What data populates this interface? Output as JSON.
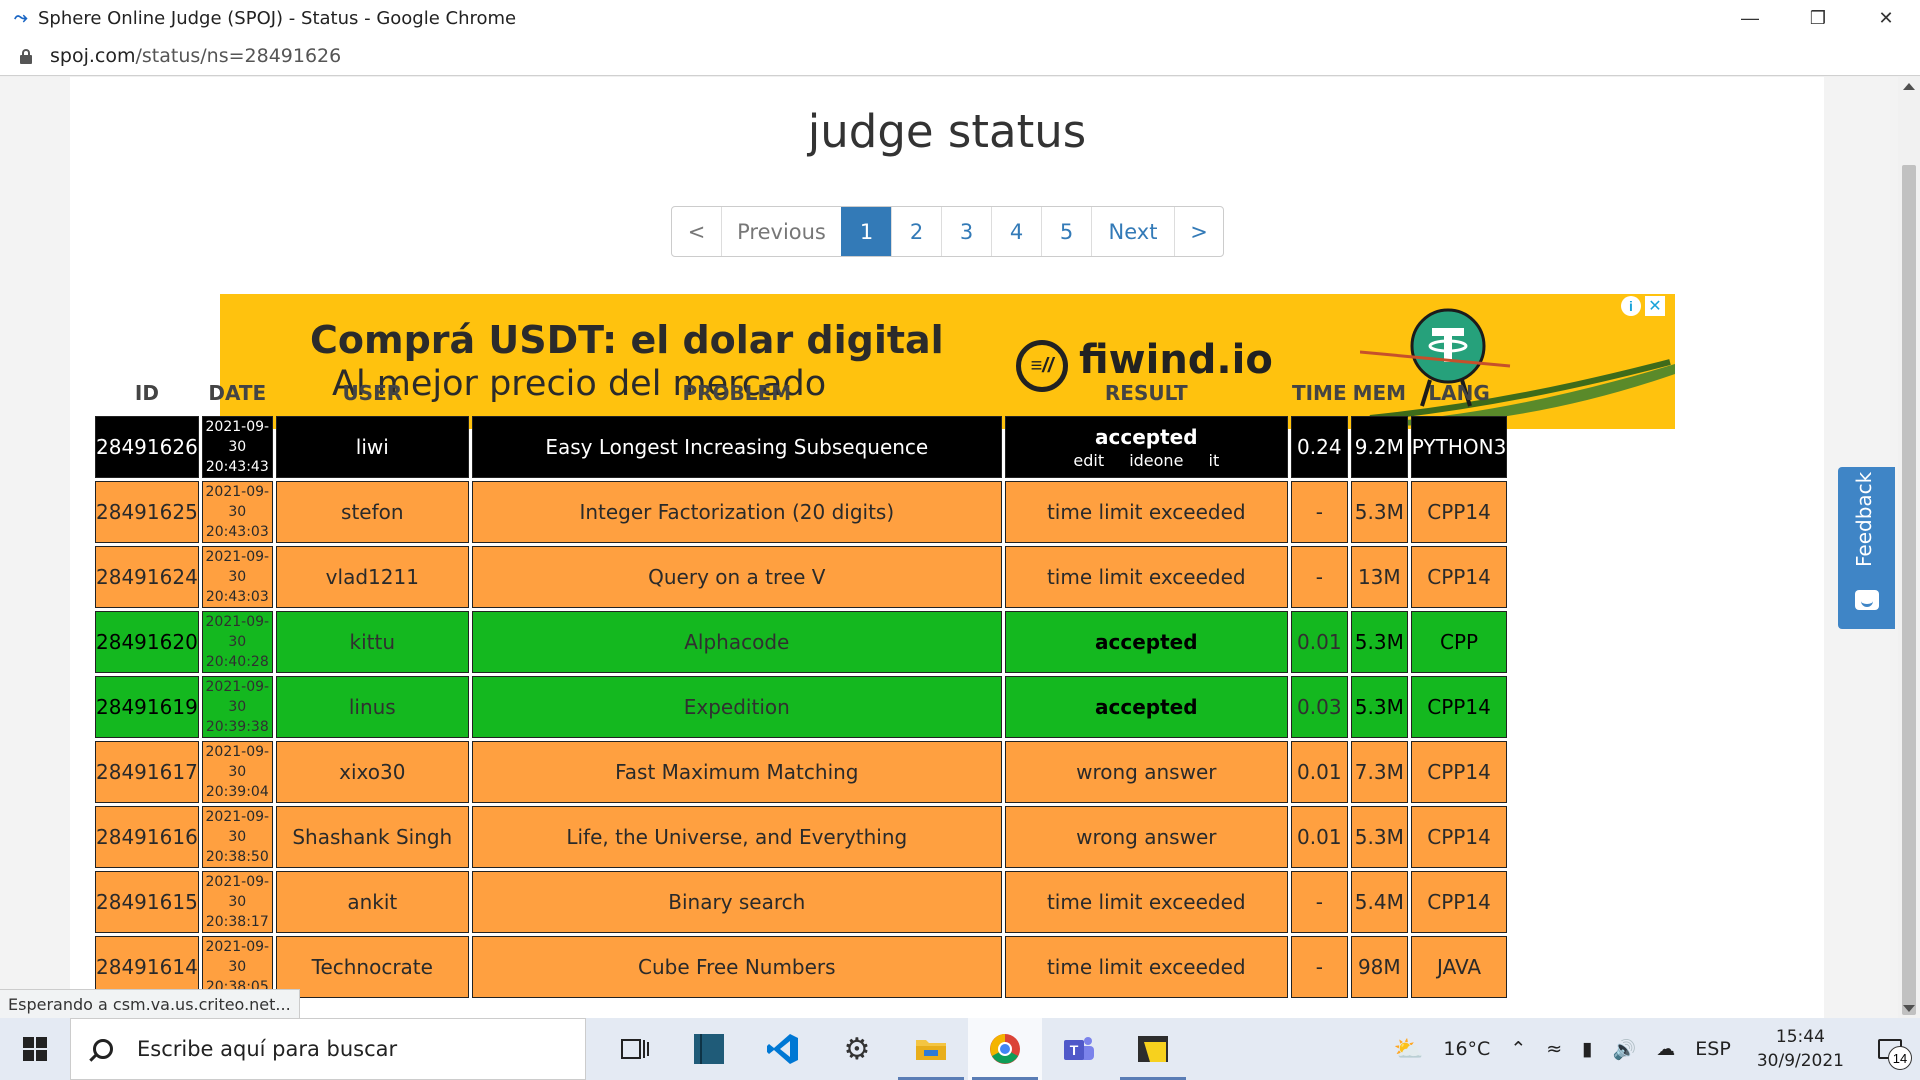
{
  "window": {
    "title": "Sphere Online Judge (SPOJ) - Status - Google Chrome",
    "minimize": "—",
    "maximize": "❒",
    "close": "✕"
  },
  "address": {
    "host": "spoj.com",
    "path": "/status/ns=28491626"
  },
  "heading": "judge status",
  "pagination": {
    "prev_arrow": "<",
    "prev": "Previous",
    "pages": [
      "1",
      "2",
      "3",
      "4",
      "5"
    ],
    "active": "1",
    "next": "Next",
    "next_arrow": ">"
  },
  "ad": {
    "line1": "Comprá USDT: el dolar digital",
    "line2": "Al mejor precio del mercado",
    "brand": "fiwind.io",
    "brand_icon_text": "≡//",
    "info": "i",
    "close": "✕"
  },
  "table": {
    "headers": [
      "ID",
      "DATE",
      "USER",
      "PROBLEM",
      "RESULT",
      "TIME",
      "MEM",
      "LANG"
    ],
    "rows": [
      {
        "id": "28491626",
        "date": "2021-09-30",
        "time_of_day": "20:43:43",
        "user": "liwi",
        "problem": "Easy Longest Increasing Subsequence",
        "result": "accepted",
        "result_links": [
          "edit",
          "ideone it"
        ],
        "time": "0.24",
        "mem": "9.2M",
        "lang": "PYTHON3",
        "style": "black"
      },
      {
        "id": "28491625",
        "date": "2021-09-30",
        "time_of_day": "20:43:03",
        "user": "stefon",
        "problem": "Integer Factorization (20 digits)",
        "result": "time limit exceeded",
        "time": "-",
        "mem": "5.3M",
        "lang": "CPP14",
        "style": "orange"
      },
      {
        "id": "28491624",
        "date": "2021-09-30",
        "time_of_day": "20:43:03",
        "user": "vlad1211",
        "problem": "Query on a tree V",
        "result": "time limit exceeded",
        "time": "-",
        "mem": "13M",
        "lang": "CPP14",
        "style": "orange"
      },
      {
        "id": "28491620",
        "date": "2021-09-30",
        "time_of_day": "20:40:28",
        "user": "kittu",
        "problem": "Alphacode",
        "result": "accepted",
        "time": "0.01",
        "mem": "5.3M",
        "lang": "CPP",
        "style": "green"
      },
      {
        "id": "28491619",
        "date": "2021-09-30",
        "time_of_day": "20:39:38",
        "user": "linus",
        "problem": "Expedition",
        "result": "accepted",
        "time": "0.03",
        "mem": "5.3M",
        "lang": "CPP14",
        "style": "green"
      },
      {
        "id": "28491617",
        "date": "2021-09-30",
        "time_of_day": "20:39:04",
        "user": "xixo30",
        "problem": "Fast Maximum Matching",
        "result": "wrong answer",
        "time": "0.01",
        "mem": "7.3M",
        "lang": "CPP14",
        "style": "orange"
      },
      {
        "id": "28491616",
        "date": "2021-09-30",
        "time_of_day": "20:38:50",
        "user": "Shashank Singh",
        "problem": "Life, the Universe, and Everything",
        "result": "wrong answer",
        "time": "0.01",
        "mem": "5.3M",
        "lang": "CPP14",
        "style": "orange"
      },
      {
        "id": "28491615",
        "date": "2021-09-30",
        "time_of_day": "20:38:17",
        "user": "ankit",
        "problem": "Binary search",
        "result": "time limit exceeded",
        "time": "-",
        "mem": "5.4M",
        "lang": "CPP14",
        "style": "orange"
      },
      {
        "id": "28491614",
        "date": "2021-09-30",
        "time_of_day": "20:38:05",
        "user": "Technocrate",
        "problem": "Cube Free Numbers",
        "result": "time limit exceeded",
        "time": "-",
        "mem": "98M",
        "lang": "JAVA",
        "style": "orange"
      }
    ]
  },
  "feedback": "Feedback",
  "status_popup": "Esperando a csm.va.us.criteo.net...",
  "taskbar": {
    "search_placeholder": "Escribe aquí para buscar",
    "weather": "16°C",
    "lang": "ESP",
    "time": "15:44",
    "date": "30/9/2021",
    "notifications": "14"
  },
  "colors": {
    "black_row": "#000000",
    "orange_row": "#ffa040",
    "green_row": "#14b81f",
    "pagination_active": "#337ab7",
    "ad_bg": "#ffc20e",
    "feedback_bg": "#3f85c6"
  }
}
